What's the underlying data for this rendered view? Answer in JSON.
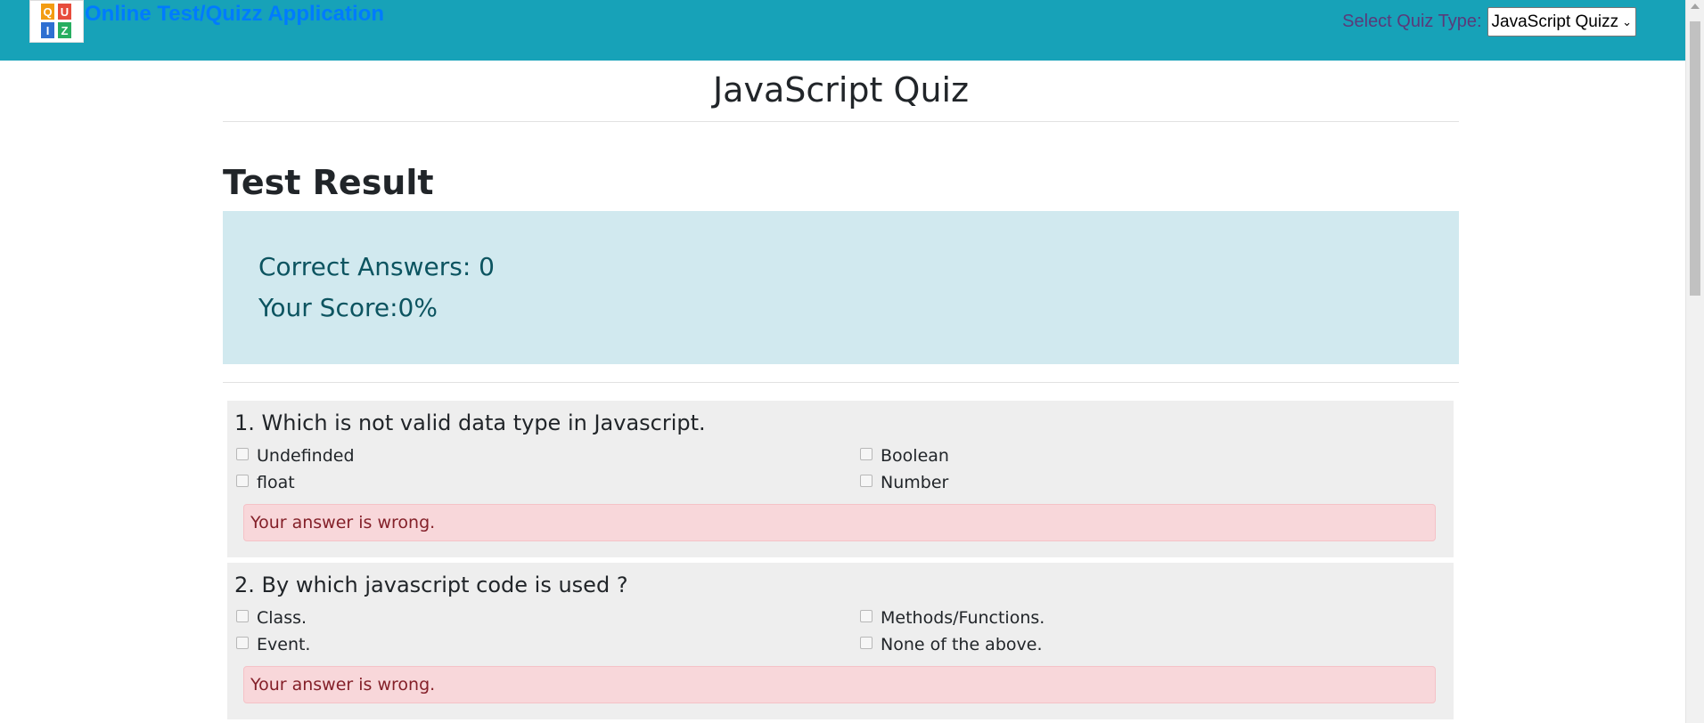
{
  "header": {
    "brand": "Online Test/Quizz Application",
    "logo_letters": [
      "Q",
      "U",
      "I",
      "Z"
    ],
    "select_label": "Select Quiz Type:",
    "select_value": "JavaScript Quizz",
    "background": "#17a2b8",
    "brand_color": "#007bff"
  },
  "main": {
    "page_title": "JavaScript Quiz",
    "section_title": "Test Result",
    "result": {
      "correct_answers": "Correct Answers: 0",
      "score": "Your Score:0%"
    },
    "questions": [
      {
        "text": "1. Which is not valid data type in Javascript.",
        "options": [
          "Undefinded",
          "Boolean",
          "float",
          "Number"
        ],
        "feedback": "Your answer is wrong."
      },
      {
        "text": "2. By which javascript code is used ?",
        "options": [
          "Class.",
          "Methods/Functions.",
          "Event.",
          "None of the above."
        ],
        "feedback": "Your answer is wrong."
      }
    ]
  },
  "colors": {
    "result_bg": "#d1e9ef",
    "result_text": "#0c5460",
    "question_bg": "#eeeeee",
    "alert_bg": "#f8d7da",
    "alert_text": "#842029"
  }
}
